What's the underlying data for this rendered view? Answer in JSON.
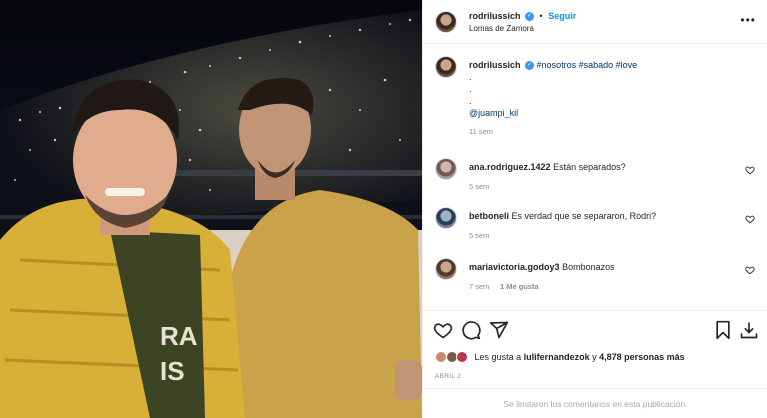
{
  "post": {
    "username": "rodrilussich",
    "follow_label": "Seguir",
    "location": "Lomas de Zamora",
    "more_label": "•••"
  },
  "caption": {
    "username": "rodrilussich",
    "hashtags": "#nosotros #sabado #love",
    "dots": [
      ".",
      ".",
      "."
    ],
    "mention": "@juampi_kil",
    "time": "11 sem"
  },
  "comments": [
    {
      "username": "ana.rodriguez.1422",
      "text": "Están separados?",
      "time": "5 sem",
      "likes": ""
    },
    {
      "username": "betboneli",
      "text": "Es verdad que se separaron, Rodri?",
      "time": "5 sem",
      "likes": ""
    },
    {
      "username": "mariavictoria.godoy3",
      "text": "Bombonazos",
      "time": "7 sem",
      "likes": "1 Me gusta"
    }
  ],
  "likes": {
    "prefix": "Les gusta a ",
    "user": "lulifernandezok",
    "middle": " y ",
    "count": "4,878 personas más"
  },
  "date": "ABRIL 2",
  "footer": "Se limitaron los comentarios en esta publicación.",
  "icons": [
    "heart-icon",
    "comment-icon",
    "share-icon",
    "bookmark-icon",
    "download-icon",
    "verified-icon"
  ],
  "colors": {
    "link": "#0095f6",
    "tag": "#00376b",
    "verified": "#3897f0",
    "muted": "#8e8e8e"
  }
}
